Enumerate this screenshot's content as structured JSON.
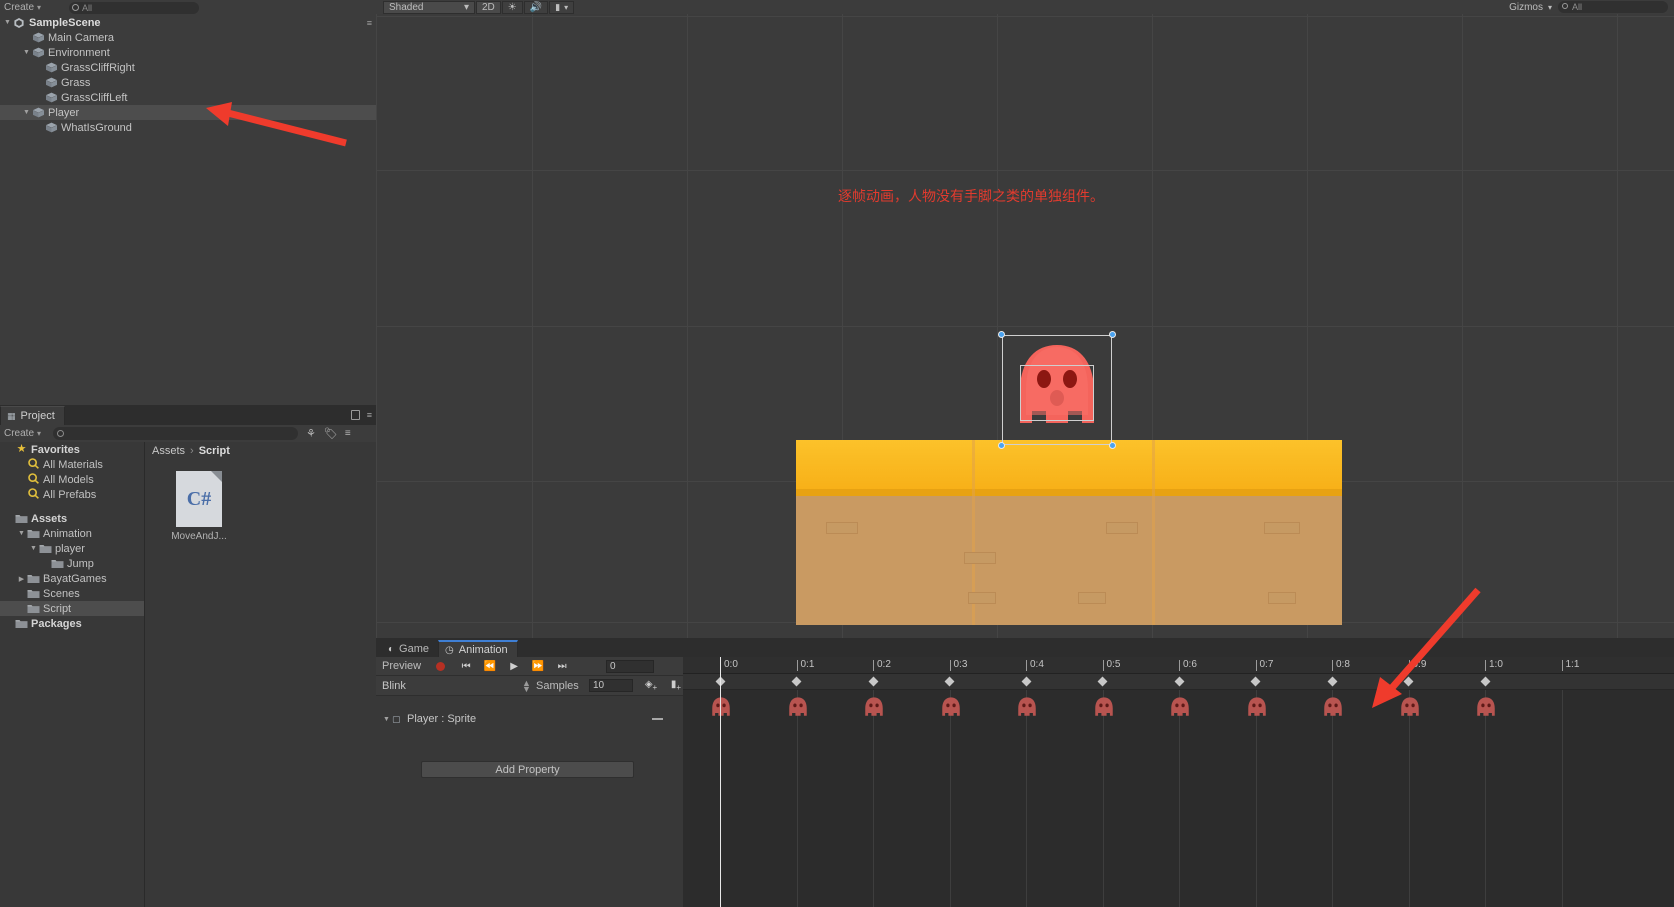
{
  "app": {
    "name": "Unity Editor",
    "theme_bg": "#383838",
    "accent": "#3f7fd4",
    "annotation_color": "#e23b2e"
  },
  "hierarchy": {
    "create_label": "Create",
    "search_placeholder": "All",
    "search_icon": "search-icon",
    "scene_name": "SampleScene",
    "items": [
      {
        "label": "Main Camera",
        "depth": 1,
        "expandable": false,
        "expanded": false,
        "selected": false
      },
      {
        "label": "Environment",
        "depth": 1,
        "expandable": true,
        "expanded": true,
        "selected": false
      },
      {
        "label": "GrassCliffRight",
        "depth": 2,
        "expandable": false,
        "expanded": false,
        "selected": false
      },
      {
        "label": "Grass",
        "depth": 2,
        "expandable": false,
        "expanded": false,
        "selected": false
      },
      {
        "label": "GrassCliffLeft",
        "depth": 2,
        "expandable": false,
        "expanded": false,
        "selected": false
      },
      {
        "label": "Player",
        "depth": 1,
        "expandable": true,
        "expanded": true,
        "selected": true
      },
      {
        "label": "WhatIsGround",
        "depth": 2,
        "expandable": false,
        "expanded": false,
        "selected": false
      }
    ]
  },
  "project": {
    "tab_label": "Project",
    "create_label": "Create",
    "search_placeholder": "",
    "lock_icon": "lock-icon",
    "tree": [
      {
        "label": "Favorites",
        "depth": 0,
        "kind": "star",
        "expandable": false,
        "expanded": false,
        "selected": false
      },
      {
        "label": "All Materials",
        "depth": 1,
        "kind": "search",
        "expandable": false,
        "expanded": false,
        "selected": false
      },
      {
        "label": "All Models",
        "depth": 1,
        "kind": "search",
        "expandable": false,
        "expanded": false,
        "selected": false
      },
      {
        "label": "All Prefabs",
        "depth": 1,
        "kind": "search",
        "expandable": false,
        "expanded": false,
        "selected": false
      },
      {
        "label": "",
        "depth": 0,
        "kind": "spacer",
        "expandable": false,
        "expanded": false,
        "selected": false
      },
      {
        "label": "Assets",
        "depth": 0,
        "kind": "folder",
        "expandable": false,
        "expanded": false,
        "selected": false
      },
      {
        "label": "Animation",
        "depth": 1,
        "kind": "folder",
        "expandable": true,
        "expanded": true,
        "selected": false
      },
      {
        "label": "player",
        "depth": 2,
        "kind": "folder",
        "expandable": true,
        "expanded": true,
        "selected": false
      },
      {
        "label": "Jump",
        "depth": 3,
        "kind": "folder",
        "expandable": false,
        "expanded": false,
        "selected": false
      },
      {
        "label": "BayatGames",
        "depth": 1,
        "kind": "folder",
        "expandable": true,
        "expanded": false,
        "selected": false
      },
      {
        "label": "Scenes",
        "depth": 1,
        "kind": "folder",
        "expandable": false,
        "expanded": false,
        "selected": false
      },
      {
        "label": "Script",
        "depth": 1,
        "kind": "folder",
        "expandable": false,
        "expanded": false,
        "selected": true
      },
      {
        "label": "Packages",
        "depth": 0,
        "kind": "folder",
        "expandable": false,
        "expanded": false,
        "selected": false
      }
    ],
    "breadcrumb": [
      "Assets",
      "Script"
    ],
    "breadcrumb_sep": "›",
    "assets": [
      {
        "name": "MoveAndJ...",
        "type": "C#"
      }
    ]
  },
  "scene": {
    "toolbar": {
      "draw_mode": "Shaded",
      "dropdown_caret": "▾",
      "two_d_label": "2D",
      "lighting_icon": "sun-icon",
      "audio_icon": "speaker-icon",
      "fx_icon": "effects-icon",
      "fx_caret": "▾",
      "gizmos_label": "Gizmos",
      "gizmos_caret": "▾",
      "search_placeholder": "All",
      "search_icon": "search-icon"
    },
    "annotation": "逐帧动画，人物没有手脚之类的单独组件。",
    "player_sprite": {
      "name": "player-sprite",
      "color": "#f0615a"
    },
    "ground": {
      "grass_color": "#fcc22a",
      "dirt_color": "#c99a63"
    }
  },
  "animation": {
    "tabs": [
      {
        "label": "Game",
        "icon": "game-icon",
        "active": false
      },
      {
        "label": "Animation",
        "icon": "animation-icon",
        "active": true
      }
    ],
    "preview_label": "Preview",
    "record_icon": "record-icon",
    "transport": [
      {
        "name": "first-frame-button",
        "glyph": "⏮"
      },
      {
        "name": "prev-frame-button",
        "glyph": "⏴"
      },
      {
        "name": "play-button",
        "glyph": "▶"
      },
      {
        "name": "next-frame-button",
        "glyph": "⏵"
      },
      {
        "name": "last-frame-button",
        "glyph": "⏭"
      }
    ],
    "frame_value": "0",
    "clip_name": "Blink",
    "clip_caret": "↕",
    "samples_label": "Samples",
    "samples_value": "10",
    "add_keyframe_icon": "add-keyframe-icon",
    "add_event_icon": "add-event-icon",
    "property_row": "Player : Sprite",
    "add_property_label": "Add Property",
    "timeline": {
      "ticks": [
        "0:0",
        "0:1",
        "0:2",
        "0:3",
        "0:4",
        "0:5",
        "0:6",
        "0:7",
        "0:8",
        "0:9",
        "1:0",
        "1:1"
      ],
      "playhead_time": "0:0",
      "keyframe_count": 11,
      "sprite_frame_count": 11
    }
  }
}
